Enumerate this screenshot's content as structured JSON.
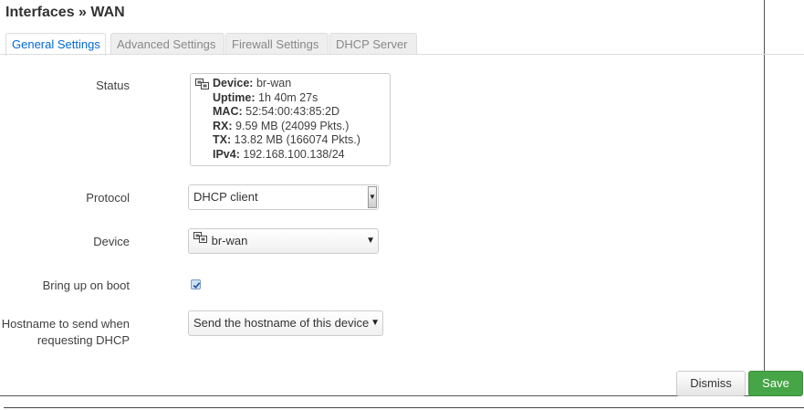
{
  "title": "Interfaces » WAN",
  "tabs": [
    {
      "label": "General Settings",
      "active": true
    },
    {
      "label": "Advanced Settings"
    },
    {
      "label": "Firewall Settings"
    },
    {
      "label": "DHCP Server"
    }
  ],
  "status": {
    "label": "Status",
    "icon": "ethernet-port-icon",
    "lines": [
      {
        "key": "Device:",
        "value": "br-wan"
      },
      {
        "key": "Uptime:",
        "value": "1h 40m 27s"
      },
      {
        "key": "MAC:",
        "value": "52:54:00:43:85:2D"
      },
      {
        "key": "RX:",
        "value": "9.59 MB (24099 Pkts.)"
      },
      {
        "key": "TX:",
        "value": "13.82 MB (166074 Pkts.)"
      },
      {
        "key": "IPv4:",
        "value": "192.168.100.138/24"
      }
    ]
  },
  "protocol": {
    "label": "Protocol",
    "value": "DHCP client"
  },
  "device": {
    "label": "Device",
    "value": "br-wan",
    "icon": "ethernet-port-icon"
  },
  "boot": {
    "label": "Bring up on boot",
    "checked": true
  },
  "hostname": {
    "label": "Hostname to send when requesting DHCP",
    "value": "Send the hostname of this device"
  },
  "buttons": {
    "dismiss": "Dismiss",
    "save": "Save"
  },
  "colors": {
    "accent": "#0069d6",
    "save": "#46a546"
  }
}
